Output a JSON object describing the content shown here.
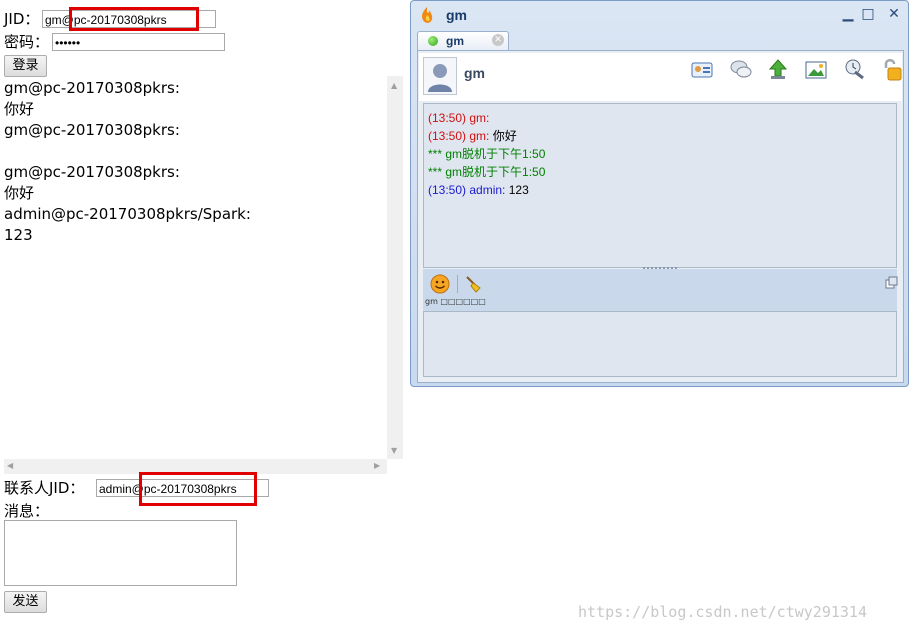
{
  "login": {
    "jid_label": "JID：",
    "jid_value": "gm@pc-20170308pkrs",
    "password_label": "密码：",
    "password_value": "••••••",
    "login_button": "登录"
  },
  "log": [
    "gm@pc-20170308pkrs:",
    "你好",
    "gm@pc-20170308pkrs:",
    "",
    "gm@pc-20170308pkrs:",
    "你好",
    "admin@pc-20170308pkrs/Spark:",
    "123"
  ],
  "send": {
    "contact_label": "联系人JID：",
    "contact_value": "admin@pc-20170308pkrs",
    "message_label": "消息：",
    "message_value": "",
    "send_button": "发送"
  },
  "chat_window": {
    "title": "gm",
    "tab_label": "gm",
    "contact_name": "gm",
    "messages": [
      {
        "time": "(13:50)",
        "sender": "gm:",
        "text": "",
        "color": "#d01010"
      },
      {
        "time": "(13:50)",
        "sender": "gm:",
        "text": "你好",
        "color": "#d01010"
      },
      {
        "time": "",
        "sender": "",
        "text": "*** gm脱机于下午1:50",
        "color": "#008000"
      },
      {
        "time": "",
        "sender": "",
        "text": "*** gm脱机于下午1:50",
        "color": "#008000"
      },
      {
        "time": "(13:50)",
        "sender": "admin:",
        "text": "123",
        "color": "#1a1acc"
      }
    ],
    "status_text": "gm □□□□□□",
    "accent_color": "#1a3a6a"
  },
  "watermark": "https://blog.csdn.net/ctwy291314"
}
